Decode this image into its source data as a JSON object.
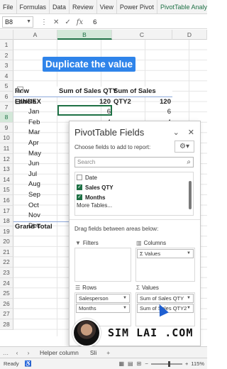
{
  "ribbon": {
    "tabs": [
      "File",
      "Formulas",
      "Data",
      "Review",
      "View",
      "Power Pivot",
      "PivotTable Analyze"
    ]
  },
  "formula_bar": {
    "name_box": "B8",
    "value": "6",
    "fx_label": "fx"
  },
  "columns": [
    "A",
    "B",
    "C",
    "D"
  ],
  "rows": [
    "1",
    "2",
    "3",
    "4",
    "5",
    "6",
    "7",
    "8",
    "9",
    "10",
    "11",
    "12",
    "13",
    "14",
    "15",
    "16",
    "17",
    "18",
    "19",
    "20",
    "21",
    "22",
    "23",
    "24",
    "25",
    "26",
    "27",
    "28"
  ],
  "banner": "Duplicate the value",
  "pivot": {
    "header": {
      "row_labels": "Row Labels",
      "col1": "Sum of Sales QTY",
      "col2": "Sum of Sales QTY2"
    },
    "group": {
      "label": "INDEX",
      "v1": "120",
      "v2": "120"
    },
    "months": [
      {
        "label": "Jan",
        "v1": "6",
        "v2": "6"
      },
      {
        "label": "Feb",
        "v1": "4",
        "v2": "4"
      },
      {
        "label": "Mar",
        "v1": "",
        "v2": ""
      },
      {
        "label": "Apr",
        "v1": "",
        "v2": ""
      },
      {
        "label": "May",
        "v1": "",
        "v2": ""
      },
      {
        "label": "Jun",
        "v1": "",
        "v2": ""
      },
      {
        "label": "Jul",
        "v1": "",
        "v2": ""
      },
      {
        "label": "Aug",
        "v1": "",
        "v2": ""
      },
      {
        "label": "Sep",
        "v1": "",
        "v2": ""
      },
      {
        "label": "Oct",
        "v1": "",
        "v2": ""
      },
      {
        "label": "Nov",
        "v1": "",
        "v2": ""
      },
      {
        "label": "Dec",
        "v1": "",
        "v2": ""
      }
    ],
    "grand_total": "Grand Total"
  },
  "pane": {
    "title": "PivotTable Fields",
    "choose_text": "Choose fields to add to report:",
    "search_placeholder": "Search",
    "fields": [
      {
        "label": "Date",
        "checked": false
      },
      {
        "label": "Sales QTY",
        "checked": true
      },
      {
        "label": "Months",
        "checked": true
      }
    ],
    "more_tables": "More Tables...",
    "drag_text": "Drag fields between areas below:",
    "filters_label": "Filters",
    "columns_label": "Columns",
    "columns_chip": "Σ Values",
    "rows_label": "Rows",
    "rows_chips": [
      "Salesperson",
      "Months"
    ],
    "values_label": "Values",
    "values_chips": [
      "Sum of Sales QTY",
      "Sum of Sales QTY2"
    ]
  },
  "watermark": "SIM LAI .COM",
  "sheet_tabs": [
    "Helper column",
    "Sli"
  ],
  "status": {
    "ready": "Ready",
    "zoom": "115%"
  }
}
